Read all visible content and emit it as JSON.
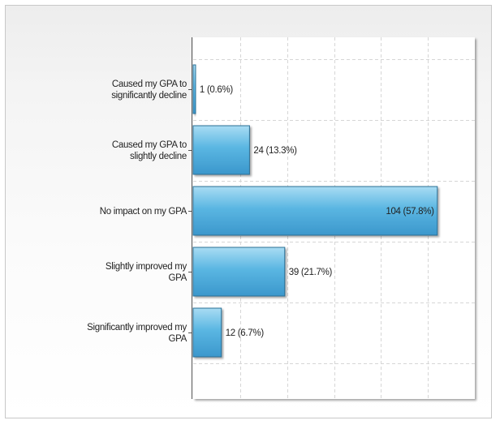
{
  "chart_data": {
    "type": "bar",
    "orientation": "horizontal",
    "categories": [
      [
        "Caused my GPA to",
        "significantly decline"
      ],
      [
        "Caused my GPA to",
        "slightly decline"
      ],
      [
        "No impact on my GPA"
      ],
      [
        "Slightly improved my",
        "GPA"
      ],
      [
        "Significantly improved my",
        "GPA"
      ]
    ],
    "values": [
      1,
      24,
      104,
      39,
      12
    ],
    "value_labels": [
      "1 (0.6%)",
      "24 (13.3%)",
      "104 (57.8%)",
      "39 (21.7%)",
      "12 (6.7%)"
    ],
    "xlim": [
      0,
      120
    ],
    "grid": true,
    "colors": {
      "bar_top": "#a9dcf3",
      "bar_mid": "#5ab6e2",
      "bar_bottom": "#3b97cc",
      "bar_border": "#2b6f96",
      "grid": "#d6d6d6",
      "axis": "#555555"
    }
  }
}
